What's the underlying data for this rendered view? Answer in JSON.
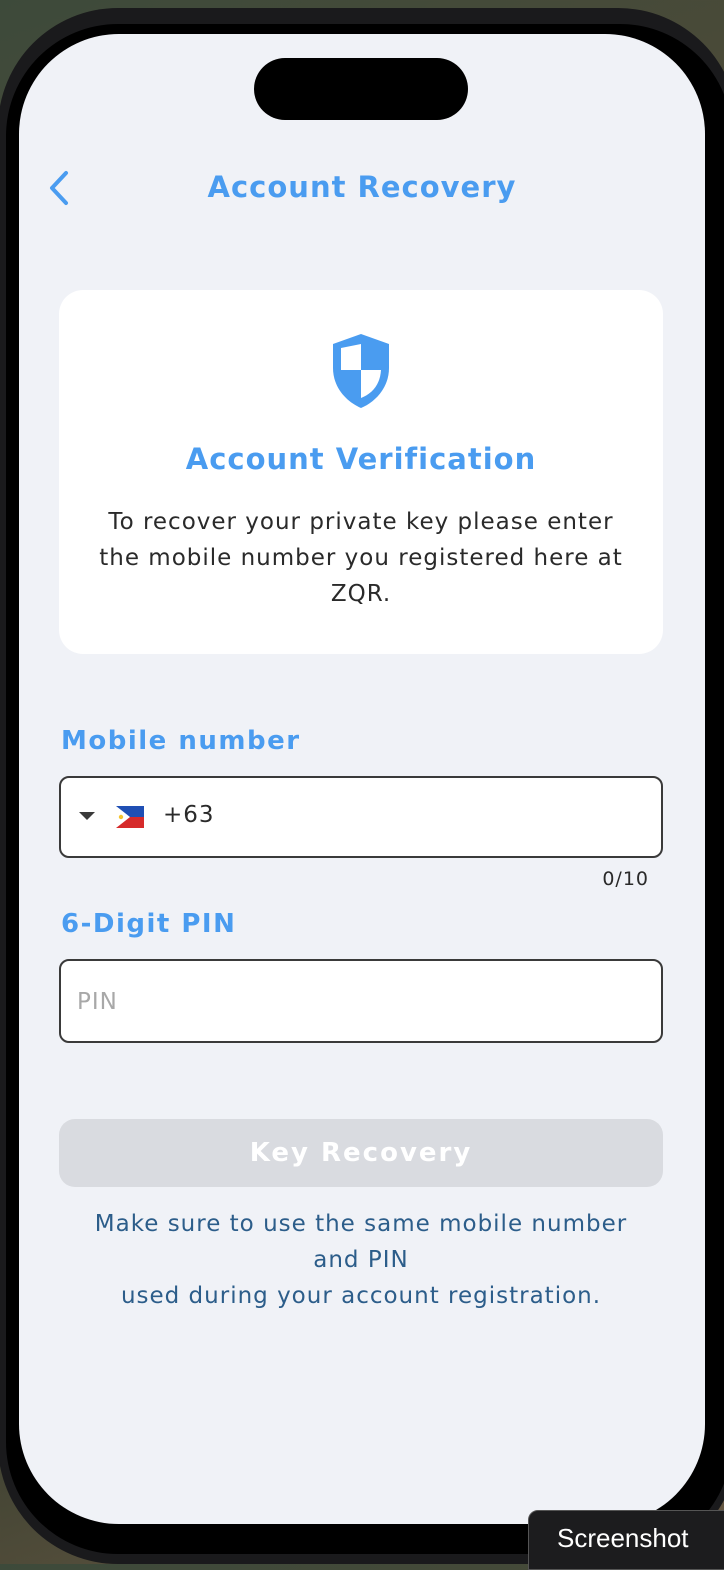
{
  "nav": {
    "title": "Account Recovery"
  },
  "card": {
    "title": "Account Verification",
    "description": "To recover your private key please enter the mobile number you registered here at ZQR."
  },
  "mobile": {
    "label": "Mobile number",
    "country_code": "+63",
    "country_flag": "philippines-flag-icon",
    "value": "",
    "counter": "0/10"
  },
  "pin": {
    "label": "6-Digit PIN",
    "placeholder": "PIN",
    "value": ""
  },
  "recover_button": {
    "label": "Key Recovery"
  },
  "footnote": {
    "line1": "Make sure to use the same mobile number and PIN",
    "line2": "used during your account registration."
  },
  "overlay": {
    "screenshot_label": "Screenshot"
  },
  "colors": {
    "accent": "#4a9cf0",
    "button_disabled": "#d9dbe0",
    "footnote": "#2c5d8a",
    "screen_bg": "#f0f2f7"
  }
}
